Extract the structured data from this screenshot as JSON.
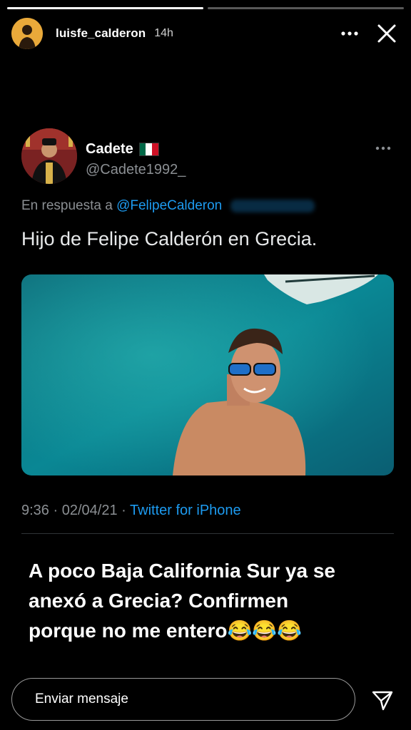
{
  "story": {
    "username": "luisfe_calderon",
    "time_ago": "14h",
    "progress_segments": [
      1,
      0
    ],
    "avatar_color": "#e9a93a",
    "caption_lines": [
      "A poco Baja California Sur ya se",
      "anexó a Grecia? Confirmen",
      "porque no me entero😂😂😂"
    ],
    "message_placeholder": "Enviar mensaje"
  },
  "tweet": {
    "display_name": "Cadete",
    "flag_emoji": "mexico-flag",
    "handle": "@Cadete1992_",
    "reply_prefix": "En respuesta a",
    "reply_mention": "@FelipeCalderon",
    "text": "Hijo de Felipe Calderón en Grecia.",
    "time": "9:36",
    "date": "02/04/21",
    "source": "Twitter for iPhone",
    "meta_separator": "·"
  },
  "colors": {
    "twitter_blue": "#1d9bf0",
    "muted": "#8b8f93",
    "background": "#000000"
  },
  "icons": [
    "more-icon",
    "close-icon",
    "send-icon"
  ]
}
